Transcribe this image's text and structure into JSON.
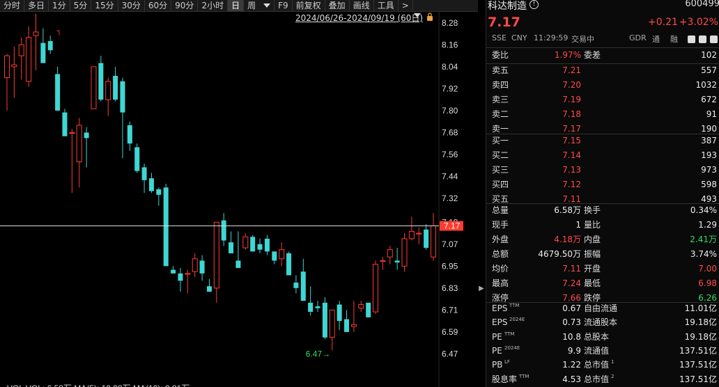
{
  "toolbar": {
    "items": [
      "分时",
      "多日",
      "1分",
      "5分",
      "15分",
      "30分",
      "60分",
      "90分",
      "2小时",
      "日",
      "周",
      "F9",
      "前复权",
      "叠加",
      "画线",
      "工具",
      ">"
    ],
    "active_index": 9
  },
  "range_label": "2024/06/26-2024/09/19 (60日)",
  "stock": {
    "name": "科达制造",
    "code": "600499",
    "price": "7.17",
    "change": "+0.21",
    "change_pct": "+3.02%",
    "exchange": "SSE",
    "currency": "CNY",
    "time": "11:29:59",
    "status": "交易中",
    "tags": [
      "GDR",
      "通",
      "融"
    ]
  },
  "order_book": {
    "ratio_label": "委比",
    "ratio_value": "1.97%",
    "diff_label": "委差",
    "diff_value": "102",
    "asks": [
      {
        "label": "卖五",
        "price": "7.21",
        "volume": "557"
      },
      {
        "label": "卖四",
        "price": "7.20",
        "volume": "1032"
      },
      {
        "label": "卖三",
        "price": "7.19",
        "volume": "672"
      },
      {
        "label": "卖二",
        "price": "7.18",
        "volume": "91"
      },
      {
        "label": "卖一",
        "price": "7.17",
        "volume": "190"
      }
    ],
    "bids": [
      {
        "label": "买一",
        "price": "7.15",
        "volume": "387"
      },
      {
        "label": "买二",
        "price": "7.14",
        "volume": "193"
      },
      {
        "label": "买三",
        "price": "7.13",
        "volume": "973"
      },
      {
        "label": "买四",
        "price": "7.12",
        "volume": "598"
      },
      {
        "label": "买五",
        "price": "7.11",
        "volume": "493"
      }
    ]
  },
  "stats": [
    {
      "l1": "总量",
      "v1": "6.58万",
      "c1": "wht",
      "l2": "换手",
      "v2": "0.34%",
      "c2": "wht"
    },
    {
      "l1": "现手",
      "v1": "1",
      "c1": "wht",
      "l2": "量比",
      "v2": "1.29",
      "c2": "wht"
    },
    {
      "l1": "外盘",
      "v1": "4.18万",
      "c1": "red",
      "l2": "内盘",
      "v2": "2.41万",
      "c2": "grn"
    },
    {
      "l1": "总额",
      "v1": "4679.50万",
      "c1": "wht",
      "l2": "振幅",
      "v2": "3.74%",
      "c2": "wht"
    },
    {
      "l1": "均价",
      "v1": "7.11",
      "c1": "red",
      "l2": "开盘",
      "v2": "7.00",
      "c2": "red"
    },
    {
      "l1": "最高",
      "v1": "7.24",
      "c1": "red",
      "l2": "最低",
      "v2": "6.98",
      "c2": "red"
    },
    {
      "l1": "涨停",
      "v1": "7.66",
      "c1": "red",
      "l2": "跌停",
      "v2": "6.26",
      "c2": "grn"
    }
  ],
  "fundamentals": [
    {
      "l1": "EPS",
      "s1": "TTM",
      "v1": "0.67",
      "l2": "自由流通",
      "s2": "",
      "v2": "11.01亿"
    },
    {
      "l1": "EPS",
      "s1": "2024E",
      "v1": "0.73",
      "l2": "流通股本",
      "s2": "",
      "v2": "19.18亿"
    },
    {
      "l1": "PE",
      "s1": "TTM",
      "v1": "10.8",
      "l2": "总股本",
      "s2": "",
      "v2": "19.18亿"
    },
    {
      "l1": "PE",
      "s1": "2024E",
      "v1": "9.9",
      "l2": "流通值",
      "s2": "",
      "v2": "137.51亿"
    },
    {
      "l1": "PB",
      "s1": "LF",
      "v1": "1.22",
      "l2": "总市值",
      "s2": "1",
      "v2": "137.51亿"
    },
    {
      "l1": "股息率",
      "s1": "TTM",
      "v1": "4.53",
      "l2": "总市值",
      "s2": "2",
      "v2": "137.51亿"
    }
  ],
  "chart_data": {
    "type": "candlestick",
    "y_ticks": [
      "8.28",
      "8.16",
      "8.04",
      "7.92",
      "7.80",
      "7.68",
      "7.56",
      "7.44",
      "7.32",
      "7.19",
      "7.07",
      "6.95",
      "6.83",
      "6.71",
      "6.59",
      "6.47"
    ],
    "ylim": [
      6.43,
      8.34
    ],
    "current_price": "7.17",
    "low_marker": "6.47",
    "high_marker": "┐",
    "volume_legend": "VOL  VOL: 6.58万  MA(5): 10.98万  MA(10): 9.81万",
    "colors": {
      "up": "#ff3b30",
      "down": "#3fd6d3"
    },
    "candles": [
      {
        "o": 7.98,
        "h": 8.11,
        "l": 7.8,
        "c": 8.1
      },
      {
        "o": 8.04,
        "h": 8.15,
        "l": 7.87,
        "c": 8.05
      },
      {
        "o": 8.1,
        "h": 8.2,
        "l": 7.97,
        "c": 8.16
      },
      {
        "o": 7.96,
        "h": 8.26,
        "l": 7.93,
        "c": 8.2
      },
      {
        "o": 8.21,
        "h": 8.33,
        "l": 8.02,
        "c": 8.23
      },
      {
        "o": 8.17,
        "h": 8.25,
        "l": 8.09,
        "c": 8.06
      },
      {
        "o": 8.18,
        "h": 8.21,
        "l": 8.11,
        "c": 8.13
      },
      {
        "o": 8.0,
        "h": 8.04,
        "l": 7.84,
        "c": 7.8
      },
      {
        "o": 7.79,
        "h": 7.81,
        "l": 7.69,
        "c": 7.66
      },
      {
        "o": 7.68,
        "h": 7.7,
        "l": 7.35,
        "c": 7.68
      },
      {
        "o": 7.52,
        "h": 7.76,
        "l": 7.38,
        "c": 7.72
      },
      {
        "o": 7.68,
        "h": 7.71,
        "l": 7.49,
        "c": 7.65
      },
      {
        "o": 7.81,
        "h": 8.04,
        "l": 7.81,
        "c": 8.04
      },
      {
        "o": 8.06,
        "h": 8.1,
        "l": 7.85,
        "c": 7.86
      },
      {
        "o": 7.86,
        "h": 7.98,
        "l": 7.77,
        "c": 7.96
      },
      {
        "o": 7.99,
        "h": 8.04,
        "l": 7.85,
        "c": 7.86
      },
      {
        "o": 7.96,
        "h": 7.98,
        "l": 7.54,
        "c": 7.79
      },
      {
        "o": 7.72,
        "h": 7.74,
        "l": 7.58,
        "c": 7.62
      },
      {
        "o": 7.6,
        "h": 7.62,
        "l": 7.46,
        "c": 7.47
      },
      {
        "o": 7.49,
        "h": 7.51,
        "l": 7.35,
        "c": 7.42
      },
      {
        "o": 7.43,
        "h": 7.46,
        "l": 7.35,
        "c": 7.36
      },
      {
        "o": 7.37,
        "h": 7.38,
        "l": 7.28,
        "c": 7.34
      },
      {
        "o": 7.38,
        "h": 7.4,
        "l": 6.96,
        "c": 6.95
      },
      {
        "o": 6.93,
        "h": 6.95,
        "l": 6.91,
        "c": 6.91
      },
      {
        "o": 6.91,
        "h": 6.94,
        "l": 6.81,
        "c": 6.87
      },
      {
        "o": 6.91,
        "h": 6.93,
        "l": 6.8,
        "c": 6.91
      },
      {
        "o": 6.92,
        "h": 7.02,
        "l": 6.89,
        "c": 6.99
      },
      {
        "o": 6.98,
        "h": 7.01,
        "l": 6.87,
        "c": 6.91
      },
      {
        "o": 6.84,
        "h": 6.88,
        "l": 6.81,
        "c": 6.81
      },
      {
        "o": 6.83,
        "h": 7.19,
        "l": 6.75,
        "c": 7.19
      },
      {
        "o": 7.2,
        "h": 7.24,
        "l": 7.06,
        "c": 7.09
      },
      {
        "o": 7.08,
        "h": 7.14,
        "l": 7.02,
        "c": 7.02
      },
      {
        "o": 6.98,
        "h": 7.14,
        "l": 6.95,
        "c": 6.94
      },
      {
        "o": 7.05,
        "h": 7.13,
        "l": 7.04,
        "c": 7.11
      },
      {
        "o": 7.11,
        "h": 7.12,
        "l": 7.04,
        "c": 7.03
      },
      {
        "o": 7.07,
        "h": 7.1,
        "l": 7.02,
        "c": 7.04
      },
      {
        "o": 7.1,
        "h": 7.12,
        "l": 7.01,
        "c": 7.03
      },
      {
        "o": 7.03,
        "h": 7.03,
        "l": 6.96,
        "c": 6.98
      },
      {
        "o": 6.99,
        "h": 7.08,
        "l": 6.95,
        "c": 7.04
      },
      {
        "o": 7.02,
        "h": 7.03,
        "l": 6.92,
        "c": 6.9
      },
      {
        "o": 6.86,
        "h": 6.9,
        "l": 6.8,
        "c": 6.83
      },
      {
        "o": 6.92,
        "h": 6.99,
        "l": 6.76,
        "c": 6.76
      },
      {
        "o": 6.75,
        "h": 6.84,
        "l": 6.68,
        "c": 6.7
      },
      {
        "o": 6.73,
        "h": 6.76,
        "l": 6.7,
        "c": 6.72
      },
      {
        "o": 6.75,
        "h": 6.78,
        "l": 6.55,
        "c": 6.56
      },
      {
        "o": 6.56,
        "h": 6.71,
        "l": 6.49,
        "c": 6.71
      },
      {
        "o": 6.74,
        "h": 6.76,
        "l": 6.6,
        "c": 6.65
      },
      {
        "o": 6.66,
        "h": 6.71,
        "l": 6.59,
        "c": 6.59
      },
      {
        "o": 6.62,
        "h": 6.76,
        "l": 6.59,
        "c": 6.63
      },
      {
        "o": 6.72,
        "h": 6.76,
        "l": 6.7,
        "c": 6.74
      },
      {
        "o": 6.75,
        "h": 6.75,
        "l": 6.67,
        "c": 6.67
      },
      {
        "o": 6.7,
        "h": 6.98,
        "l": 6.69,
        "c": 6.96
      },
      {
        "o": 6.98,
        "h": 7.0,
        "l": 6.93,
        "c": 6.98
      },
      {
        "o": 7.0,
        "h": 7.06,
        "l": 6.96,
        "c": 7.04
      },
      {
        "o": 6.98,
        "h": 7.05,
        "l": 6.93,
        "c": 6.97
      },
      {
        "o": 6.95,
        "h": 7.13,
        "l": 6.92,
        "c": 7.1
      },
      {
        "o": 7.1,
        "h": 7.22,
        "l": 7.09,
        "c": 7.14
      },
      {
        "o": 7.13,
        "h": 7.16,
        "l": 7.07,
        "c": 7.13
      },
      {
        "o": 7.15,
        "h": 7.18,
        "l": 7.04,
        "c": 7.05
      },
      {
        "o": 7.0,
        "h": 7.24,
        "l": 6.98,
        "c": 7.17
      }
    ]
  }
}
